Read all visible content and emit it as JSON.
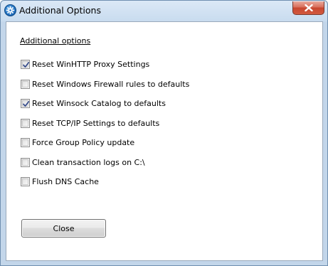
{
  "window": {
    "title": "Additional Options",
    "icon": "gear-icon",
    "close_icon": "close-icon"
  },
  "content": {
    "section_title": "Additional options",
    "options": [
      {
        "label": "Reset WinHTTP Proxy Settings",
        "checked": true
      },
      {
        "label": "Reset Windows Firewall rules to defaults",
        "checked": false
      },
      {
        "label": "Reset Winsock Catalog to defaults",
        "checked": true
      },
      {
        "label": "Reset TCP/IP Settings to defaults",
        "checked": false
      },
      {
        "label": "Force Group Policy update",
        "checked": false
      },
      {
        "label": "Clean transaction logs on C:\\",
        "checked": false
      },
      {
        "label": "Flush DNS Cache",
        "checked": false
      }
    ],
    "close_button": "Close"
  }
}
